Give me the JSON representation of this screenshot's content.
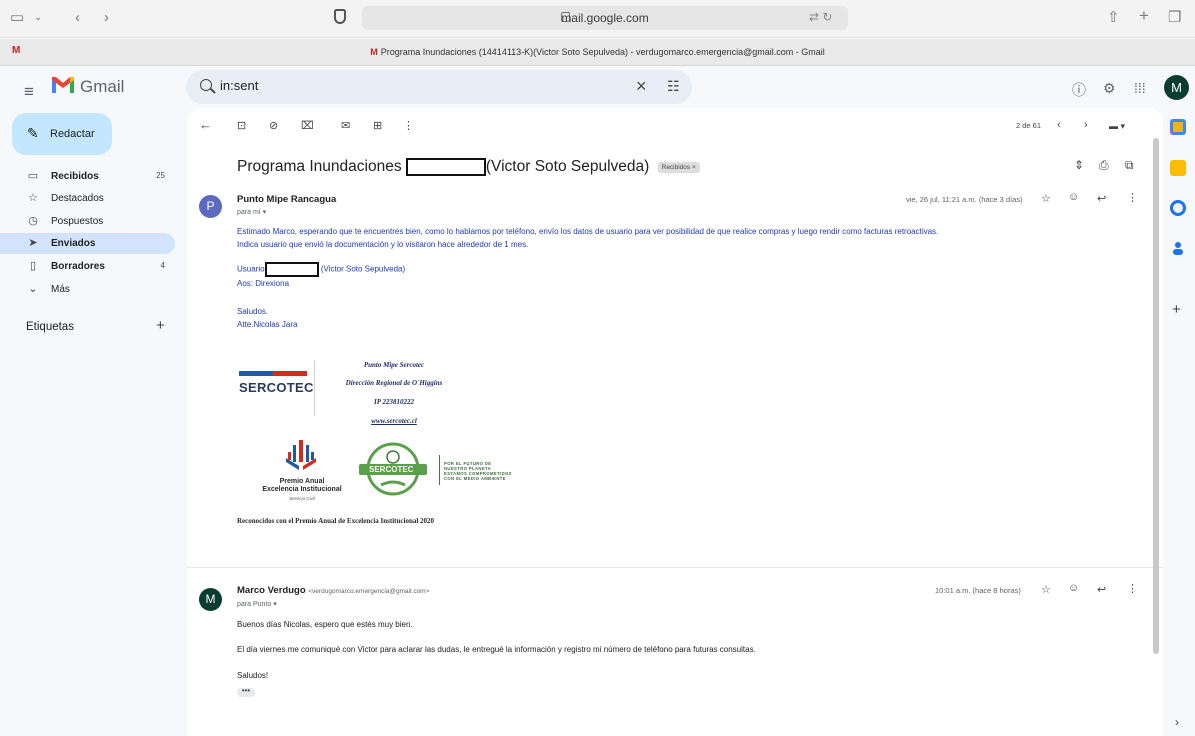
{
  "browser": {
    "url": "mail.google.com",
    "tab_title": "Programa Inundaciones (14414113-K)(Victor Soto Sepulveda) - verdugomarco.emergencia@gmail.com - Gmail",
    "tab_favicon": "M"
  },
  "gmail": {
    "brand": "Gmail",
    "search_value": "in:sent",
    "avatar_letter": "M"
  },
  "sidebar": {
    "compose": "Redactar",
    "items": [
      {
        "label": "Recibidos",
        "count": "25",
        "icon": "inbox-icon",
        "bold": true
      },
      {
        "label": "Destacados",
        "count": "",
        "icon": "star-icon",
        "bold": false
      },
      {
        "label": "Pospuestos",
        "count": "",
        "icon": "clock-icon",
        "bold": false
      },
      {
        "label": "Enviados",
        "count": "",
        "icon": "send-icon",
        "bold": true
      },
      {
        "label": "Borradores",
        "count": "4",
        "icon": "draft-icon",
        "bold": true
      },
      {
        "label": "Más",
        "count": "",
        "icon": "chevron-down-icon",
        "bold": false
      }
    ],
    "labels_heading": "Etiquetas"
  },
  "toolbar": {
    "pager": "2 de 61"
  },
  "thread": {
    "subject_start": "Programa Inundaciones",
    "subject_end": "(Victor Soto Sepulveda)",
    "label_chip": "Recibidos ×"
  },
  "message1": {
    "avatar": "P",
    "sender": "Punto Mipe Rancagua",
    "to": "para mí ▾",
    "date": "vie, 26 jul, 11:21 a.m. (hace 3 días)",
    "line1": "Estimado Marco, esperando que te encuentres bien, como lo hablamos por teléfono, envío los datos de usuario para ver posibilidad de que realice compras y luego rendir como facturas retroactivas.",
    "line2": "Indica usuario que envió la documentación y lo visitaron hace alrededor de 1 mes.",
    "user_prefix": "Usuario",
    "user_suffix": "(Victor Soto Sepulveda)",
    "aos": "Aos: Direxiona",
    "saludos": "Saludos.",
    "atte": "Atte.Nicolas Jara",
    "sig_brand": "SERCOTEC",
    "sig_lines": [
      "Punto Mipe Sercotec",
      "Dirección Regional de O´Higgins",
      "IP 223810222",
      "www.sercotec.cl"
    ],
    "premio_title": "Premio Anual",
    "premio_sub": "Excelencia Institucional",
    "premio_small": "Servicio Civil",
    "eco_brand": "SERCOTEC",
    "eco_lines": [
      "POR EL FUTURO DE",
      "NUESTRO PLANETA",
      "ESTAMOS COMPROMETIDOS",
      "CON EL MEDIO AMBIENTE"
    ],
    "reconocidos": "Reconocidos con el Premio Anual de Excelencia Institucional 2020"
  },
  "message2": {
    "avatar": "M",
    "sender": "Marco Verdugo",
    "sender_email": "<verdugomarco.emergencia@gmail.com>",
    "to": "para Punto ▾",
    "date": "10:01 a.m. (hace 8 horas)",
    "line1": "Buenos días Nicolas, espero que estés muy bien.",
    "line2": "El día viernes me comuniqué con Victor para aclarar las dudas, le entregué la información y registro mi número de teléfono para futuras consultas.",
    "line3": "Saludos!",
    "ellipsis": "•••"
  },
  "colors": {
    "compose_bg": "#c2e7ff",
    "active_nav": "#d3e3fd",
    "avatar_p": "#5c6bc0",
    "avatar_m": "#0b3d2e",
    "body_blue": "#1f3bb3"
  }
}
